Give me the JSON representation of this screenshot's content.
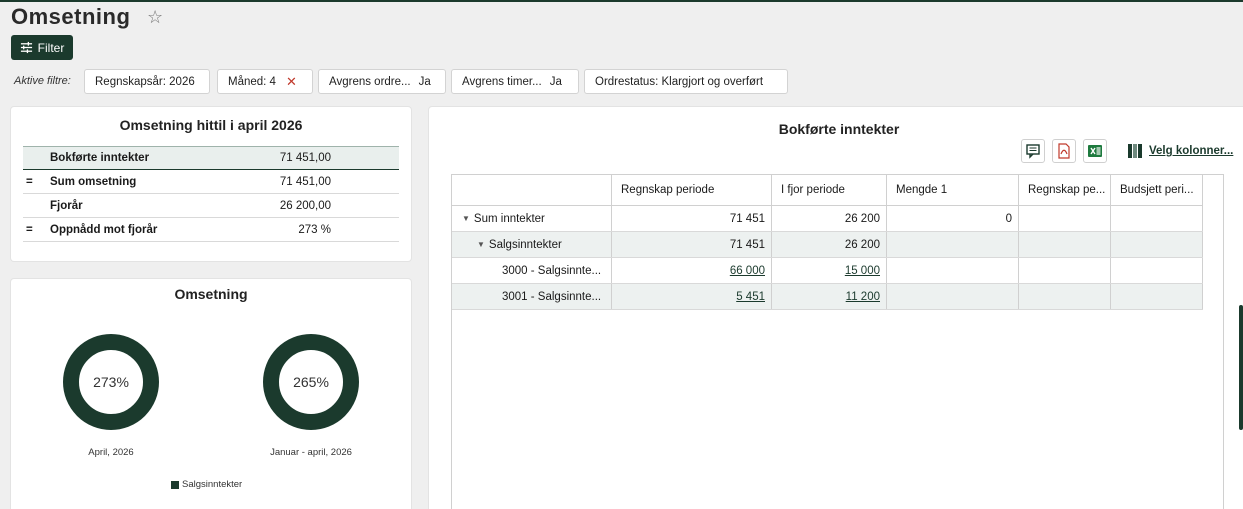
{
  "header": {
    "title": "Omsetning",
    "star_icon": "star-outline-icon"
  },
  "filter_button": {
    "label": "Filter",
    "icon": "sliders-icon"
  },
  "active_filters": {
    "label": "Aktive filtre:",
    "chips": [
      {
        "label": "Regnskapsår: 2026"
      },
      {
        "label": "Måned: 4",
        "removable": true,
        "remove_glyph": "✕"
      },
      {
        "label": "Avgrens ordre...",
        "value": "Ja"
      },
      {
        "label": "Avgrens timer...",
        "value": "Ja"
      },
      {
        "label": "Ordrestatus: Klargjort og overført"
      }
    ]
  },
  "kpi_card": {
    "title": "Omsetning hittil i april 2026",
    "rows": [
      {
        "sign": "",
        "label": "Bokførte inntekter",
        "value": "71 451,00"
      },
      {
        "sign": "=",
        "label": "Sum omsetning",
        "value": "71 451,00"
      },
      {
        "sign": "",
        "label": "Fjorår",
        "value": "26 200,00"
      },
      {
        "sign": "=",
        "label": "Oppnådd mot fjorår",
        "value": "273 %"
      }
    ]
  },
  "donut_card": {
    "title": "Omsetning",
    "donuts": [
      {
        "value_label": "273%",
        "caption": "April, 2026",
        "value_pct": 273
      },
      {
        "value_label": "265%",
        "caption": "Januar - april, 2026",
        "value_pct": 265
      }
    ],
    "legend": "Salgsinntekter",
    "color": "#1b3a2d"
  },
  "main_card": {
    "title": "Bokførte inntekter",
    "toolbar": {
      "comment_icon": "comment-icon",
      "pdf_icon": "pdf-icon",
      "excel_icon": "excel-icon",
      "columns_label": "Velg kolonner..."
    },
    "columns": [
      "",
      "Regnskap periode",
      "I fjor periode",
      "Mengde 1",
      "Regnskap pe...",
      "Budsjett peri..."
    ],
    "rows": [
      {
        "label": "Sum inntekter",
        "caret": true,
        "indent": 0,
        "regnskap": "71 451",
        "ifjor": "26 200",
        "mengde": "0",
        "link": false
      },
      {
        "label": "Salgsinntekter",
        "caret": true,
        "indent": 1,
        "regnskap": "71 451",
        "ifjor": "26 200",
        "mengde": "",
        "link": false
      },
      {
        "label": "3000 - Salgsinnte...",
        "caret": false,
        "indent": 2,
        "regnskap": "66 000",
        "ifjor": "15 000",
        "mengde": "",
        "link": true
      },
      {
        "label": "3001 - Salgsinnte...",
        "caret": false,
        "indent": 2,
        "regnskap": "5 451",
        "ifjor": "11 200",
        "mengde": "",
        "link": true
      }
    ]
  },
  "colors": {
    "brand": "#1b3a2d",
    "row_highlight": "#edf1f0",
    "danger": "#c0392b"
  }
}
